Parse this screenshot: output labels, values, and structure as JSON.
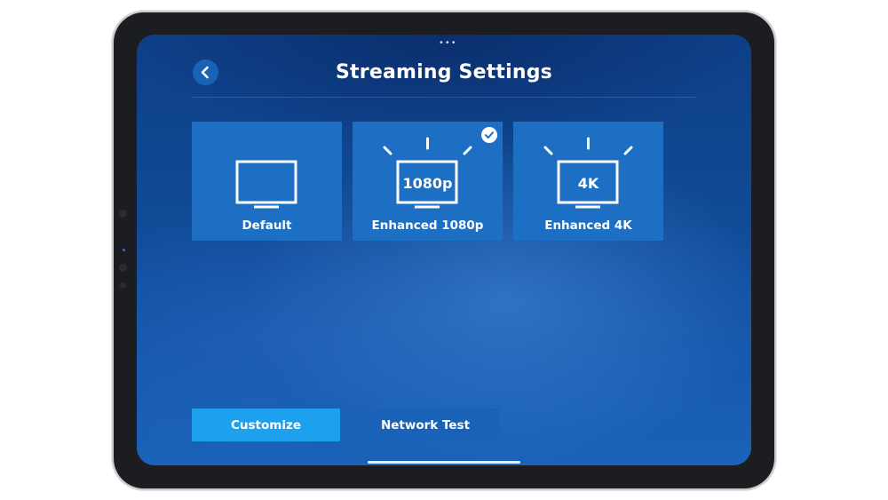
{
  "screen": {
    "title": "Streaming Settings",
    "back_icon": "chevron-left-icon"
  },
  "options": [
    {
      "label": "Default",
      "badge": "",
      "icon": "tv-icon",
      "selected": false
    },
    {
      "label": "Enhanced 1080p",
      "badge": "1080p",
      "icon": "tv-1080p-icon",
      "selected": true
    },
    {
      "label": "Enhanced 4K",
      "badge": "4K",
      "icon": "tv-4k-icon",
      "selected": false
    }
  ],
  "actions": {
    "customize_label": "Customize",
    "network_test_label": "Network Test"
  },
  "colors": {
    "tile": "#1c6fc2",
    "primary_button": "#1da1ef",
    "secondary_button": "#1a62b8",
    "background": "#114b98"
  }
}
